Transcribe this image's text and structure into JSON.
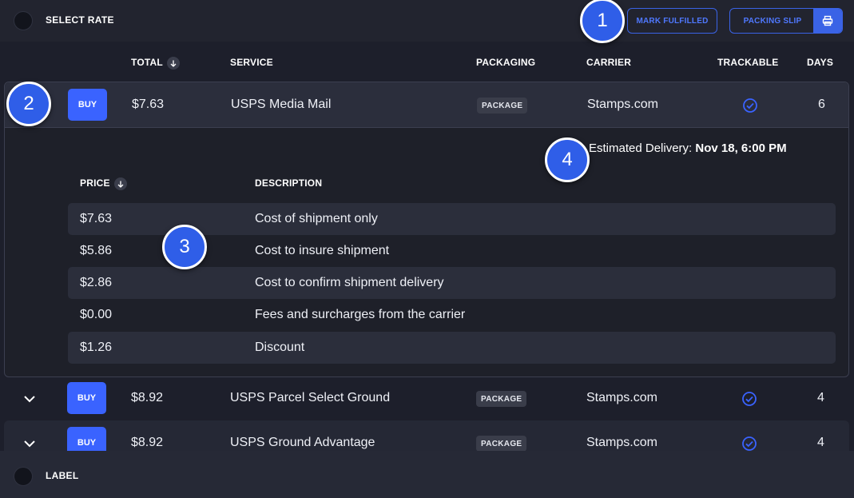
{
  "header": {
    "title": "SELECT RATE",
    "mark_fulfilled": "MARK FULFILLED",
    "packing_slip": "PACKING SLIP"
  },
  "columns": {
    "total": "TOTAL",
    "service": "SERVICE",
    "packaging": "PACKAGING",
    "carrier": "CARRIER",
    "trackable": "TRACKABLE",
    "days": "DAYS"
  },
  "rates": [
    {
      "buy": "BUY",
      "total": "$7.63",
      "service": "USPS Media Mail",
      "packaging": "PACKAGE",
      "carrier": "Stamps.com",
      "trackable": true,
      "days": "6"
    },
    {
      "buy": "BUY",
      "total": "$8.92",
      "service": "USPS Parcel Select Ground",
      "packaging": "PACKAGE",
      "carrier": "Stamps.com",
      "trackable": true,
      "days": "4"
    },
    {
      "buy": "BUY",
      "total": "$8.92",
      "service": "USPS Ground Advantage",
      "packaging": "PACKAGE",
      "carrier": "Stamps.com",
      "trackable": true,
      "days": "4"
    }
  ],
  "details": {
    "estimated_label": "Estimated Delivery: ",
    "estimated_value": "Nov 18, 6:00 PM",
    "price_header": "PRICE",
    "description_header": "DESCRIPTION",
    "rows": [
      {
        "price": "$7.63",
        "description": "Cost of shipment only"
      },
      {
        "price": "$5.86",
        "description": "Cost to insure shipment"
      },
      {
        "price": "$2.86",
        "description": "Cost to confirm shipment delivery"
      },
      {
        "price": "$0.00",
        "description": "Fees and surcharges from the carrier"
      },
      {
        "price": "$1.26",
        "description": "Discount"
      }
    ]
  },
  "footer": {
    "title": "LABEL"
  },
  "markers": [
    "1",
    "2",
    "3",
    "4"
  ],
  "colors": {
    "accent": "#3a63ff",
    "background": "#1d1f2b",
    "marker": "#2f5ee8"
  }
}
